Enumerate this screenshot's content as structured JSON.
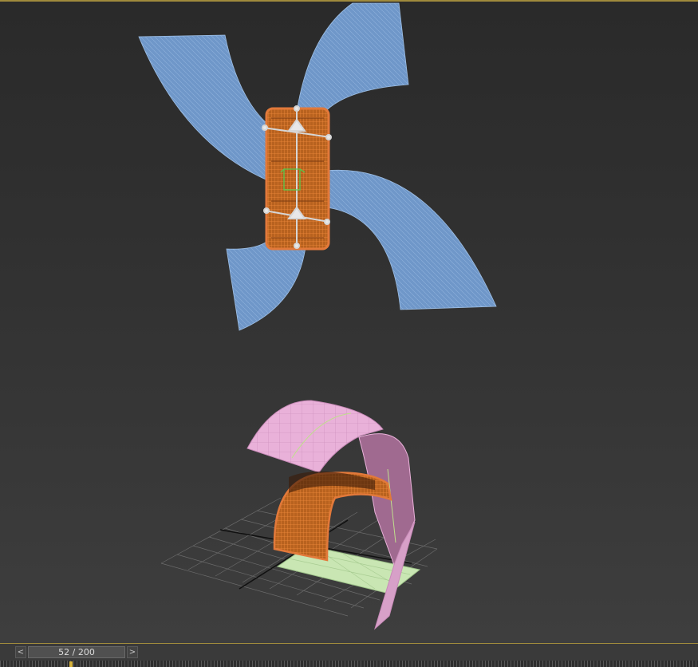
{
  "viewport": {
    "objects": [
      {
        "name": "blue-blades",
        "color": "#6f97c9"
      },
      {
        "name": "orange-panel-selected",
        "color": "#d46a24"
      },
      {
        "name": "pink-curved-surface",
        "color": "#e9b1d9"
      },
      {
        "name": "orange-arch-selected",
        "color": "#d46a24"
      },
      {
        "name": "green-plane",
        "color": "#c9e6b3"
      },
      {
        "name": "home-grid",
        "color": "#6b6b6b"
      }
    ],
    "selection_color": "#d46a24",
    "frame_border_color": "#a08a3c"
  },
  "time_slider": {
    "current_frame": 52,
    "total_frames": 200,
    "label": "52 / 200",
    "prev_symbol": "<",
    "next_symbol": ">"
  },
  "track_bar": {
    "marker_color": "#d6b23a"
  }
}
